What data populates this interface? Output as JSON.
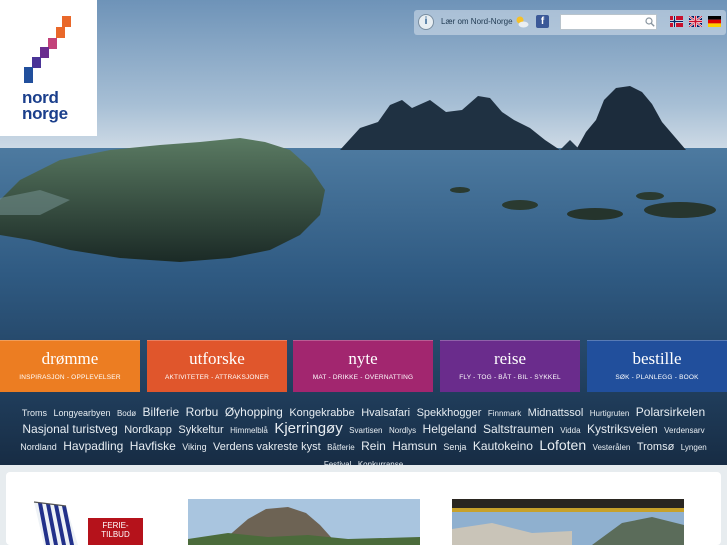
{
  "brand": {
    "logo_text_line1": "nord",
    "logo_text_line2": "norge",
    "colors": {
      "purple": "#6b2d8f",
      "orange": "#e9682a",
      "blue": "#1b3f8c"
    }
  },
  "topbar": {
    "info_icon": "info-icon",
    "about_link": "Lær om Nord-Norge",
    "weather_icon": "weather-icon",
    "facebook_icon": "facebook-icon",
    "search_placeholder": "",
    "search_icon": "search-icon",
    "flags": [
      "norway-flag",
      "uk-flag",
      "germany-flag"
    ]
  },
  "nav": [
    {
      "title": "drømme",
      "subtitle": "INSPIRASJON - OPPLEVELSER",
      "color": "#ec7d22"
    },
    {
      "title": "utforske",
      "subtitle": "AKTIVITETER - ATTRAKSJONER",
      "color": "#e0562c"
    },
    {
      "title": "nyte",
      "subtitle": "MAT - DRIKKE - OVERNATTING",
      "color": "#a2266f"
    },
    {
      "title": "reise",
      "subtitle": "FLY - TOG - BÅT - BIL - SYKKEL",
      "color": "#6a2c8c"
    },
    {
      "title": "bestille",
      "subtitle": "SØK - PLANLEGG - BOOK",
      "color": "#214f9c"
    }
  ],
  "tags": [
    {
      "text": "Troms",
      "size": 9
    },
    {
      "text": "Longyearbyen",
      "size": 9
    },
    {
      "text": "Bodø",
      "size": 8
    },
    {
      "text": "Bilferie",
      "size": 12
    },
    {
      "text": "Rorbu",
      "size": 12
    },
    {
      "text": "Øyhopping",
      "size": 12
    },
    {
      "text": "Kongekrabbe",
      "size": 11
    },
    {
      "text": "Hvalsafari",
      "size": 11
    },
    {
      "text": "Spekkhogger",
      "size": 11
    },
    {
      "text": "Finnmark",
      "size": 8
    },
    {
      "text": "Midnattssol",
      "size": 11
    },
    {
      "text": "Hurtigruten",
      "size": 8
    },
    {
      "text": "Polarsirkelen",
      "size": 12
    },
    {
      "text": "Nasjonal turistveg",
      "size": 12
    },
    {
      "text": "Nordkapp",
      "size": 11
    },
    {
      "text": "Sykkeltur",
      "size": 11
    },
    {
      "text": "Himmelblå",
      "size": 8
    },
    {
      "text": "Kjerringøy",
      "size": 15
    },
    {
      "text": "Svartisen",
      "size": 8
    },
    {
      "text": "Nordlys",
      "size": 8
    },
    {
      "text": "Helgeland",
      "size": 12
    },
    {
      "text": "Saltstraumen",
      "size": 12
    },
    {
      "text": "Vidda",
      "size": 8
    },
    {
      "text": "Kystriksveien",
      "size": 12
    },
    {
      "text": "Verdensarv",
      "size": 8
    },
    {
      "text": "Nordland",
      "size": 9
    },
    {
      "text": "Havpadling",
      "size": 12
    },
    {
      "text": "Havfiske",
      "size": 12
    },
    {
      "text": "Viking",
      "size": 9
    },
    {
      "text": "Verdens vakreste kyst",
      "size": 11
    },
    {
      "text": "Båtferie",
      "size": 8
    },
    {
      "text": "Rein",
      "size": 12
    },
    {
      "text": "Hamsun",
      "size": 12
    },
    {
      "text": "Senja",
      "size": 9
    },
    {
      "text": "Kautokeino",
      "size": 12
    },
    {
      "text": "Lofoten",
      "size": 14
    },
    {
      "text": "Vesterålen",
      "size": 8
    },
    {
      "text": "Tromsø",
      "size": 11
    },
    {
      "text": "Lyngen",
      "size": 8
    },
    {
      "text": "Festival",
      "size": 8
    },
    {
      "text": "Konkurranse",
      "size": 8
    }
  ],
  "promo": {
    "label_line1": "FERIE-",
    "label_line2": "TILBUD"
  }
}
